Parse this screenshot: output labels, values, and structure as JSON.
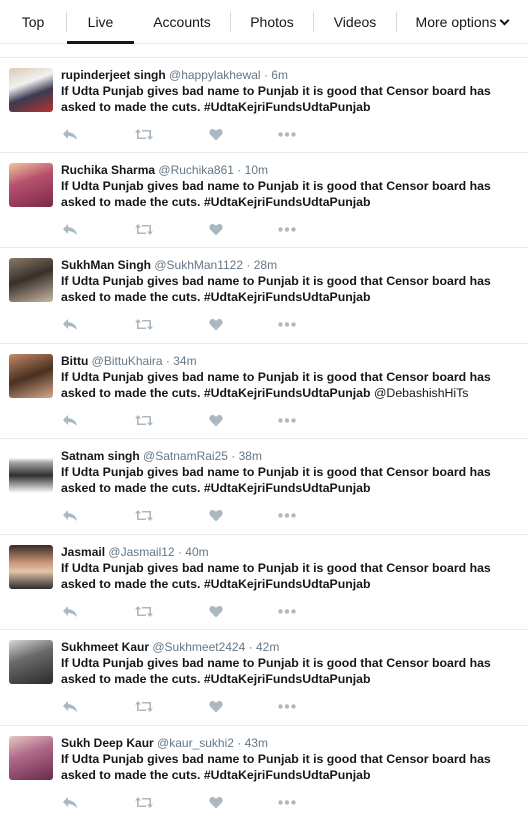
{
  "tabs": [
    {
      "label": "Top",
      "active": false
    },
    {
      "label": "Live",
      "active": true
    },
    {
      "label": "Accounts",
      "active": false
    },
    {
      "label": "Photos",
      "active": false
    },
    {
      "label": "Videos",
      "active": false
    },
    {
      "label": "More options",
      "active": false
    }
  ],
  "tweets": [
    {
      "name": "rupinderjeet singh",
      "handle": "@happylakhewal",
      "time": "6m",
      "text": "If Udta Punjab gives bad name to Punjab it is good that Censor board has asked to made the cuts. #UdtaKejriFundsUdtaPunjab",
      "mention": ""
    },
    {
      "name": "Ruchika Sharma",
      "handle": "@Ruchika861",
      "time": "10m",
      "text": "If Udta Punjab gives bad name to Punjab it is good that Censor board has asked to made the cuts. #UdtaKejriFundsUdtaPunjab",
      "mention": ""
    },
    {
      "name": "SukhMan Singh",
      "handle": "@SukhMan1122",
      "time": "28m",
      "text": "If Udta Punjab gives bad name to Punjab it is good that Censor board has asked to made the cuts. #UdtaKejriFundsUdtaPunjab",
      "mention": ""
    },
    {
      "name": "Bittu",
      "handle": "@BittuKhaira",
      "time": "34m",
      "text": "If Udta Punjab gives bad name to Punjab it is good that Censor board has asked to made the cuts. #UdtaKejriFundsUdtaPunjab",
      "mention": "@DebashishHiTs"
    },
    {
      "name": "Satnam singh",
      "handle": "@SatnamRai25",
      "time": "38m",
      "text": "If Udta Punjab gives bad name to Punjab it is good that Censor board has asked to made the cuts. #UdtaKejriFundsUdtaPunjab",
      "mention": ""
    },
    {
      "name": "Jasmail",
      "handle": "@Jasmail12",
      "time": "40m",
      "text": "If Udta Punjab gives bad name to Punjab it is good that Censor board has asked to made the cuts. #UdtaKejriFundsUdtaPunjab",
      "mention": ""
    },
    {
      "name": "Sukhmeet Kaur",
      "handle": "@Sukhmeet2424",
      "time": "42m",
      "text": "If Udta Punjab gives bad name to Punjab it is good that Censor board has asked to made the cuts. #UdtaKejriFundsUdtaPunjab",
      "mention": ""
    },
    {
      "name": "Sukh Deep Kaur",
      "handle": "@kaur_sukhi2",
      "time": "43m",
      "text": "If Udta Punjab gives bad name to Punjab it is good that Censor board has asked to made the cuts. #UdtaKejriFundsUdtaPunjab",
      "mention": ""
    }
  ],
  "icons": {
    "reply": "reply-icon",
    "retweet": "retweet-icon",
    "like": "heart-icon",
    "more": "more-icon",
    "dropdown": "chevron-down-icon"
  },
  "colors": {
    "text": "#14171a",
    "muted": "#657786",
    "action_icon": "#aab8c2",
    "border": "#e6ecf0"
  }
}
